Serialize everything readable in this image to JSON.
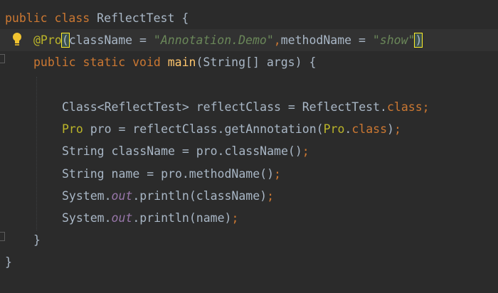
{
  "editor": {
    "lines": [
      {
        "tokens": [
          {
            "t": "public class ",
            "c": "kw"
          },
          {
            "t": "ReflectTest {",
            "c": "plain"
          }
        ]
      },
      {
        "current": true,
        "tokens": [
          {
            "t": "@Pro",
            "c": "ann"
          },
          {
            "t": "(",
            "c": "brace-hl"
          },
          {
            "t": "className = ",
            "c": "plain"
          },
          {
            "t": "\"Annotation.Demo\"",
            "c": "str"
          },
          {
            "t": ",",
            "c": "kw"
          },
          {
            "t": "methodName = ",
            "c": "plain"
          },
          {
            "t": "\"show\"",
            "c": "str"
          },
          {
            "t": ")",
            "c": "brace-hl"
          }
        ]
      },
      {
        "tokens": [
          {
            "t": "public static void ",
            "c": "kw"
          },
          {
            "t": "main",
            "c": "fn"
          },
          {
            "t": "(String[] args) {",
            "c": "plain"
          }
        ]
      },
      {
        "tokens": []
      },
      {
        "tokens": [
          {
            "t": "Class<ReflectTest> reflectClass = ReflectTest.",
            "c": "plain"
          },
          {
            "t": "class;",
            "c": "kw"
          }
        ]
      },
      {
        "tokens": [
          {
            "t": "Pro ",
            "c": "ann"
          },
          {
            "t": "pro = reflectClass.getAnnotation(",
            "c": "plain"
          },
          {
            "t": "Pro",
            "c": "ann"
          },
          {
            "t": ".",
            "c": "plain"
          },
          {
            "t": "class",
            "c": "kw"
          },
          {
            "t": ")",
            "c": "plain"
          },
          {
            "t": ";",
            "c": "kw"
          }
        ]
      },
      {
        "tokens": [
          {
            "t": "String className = pro.className()",
            "c": "plain"
          },
          {
            "t": ";",
            "c": "kw"
          }
        ]
      },
      {
        "tokens": [
          {
            "t": "String name = pro.methodName()",
            "c": "plain"
          },
          {
            "t": ";",
            "c": "kw"
          }
        ]
      },
      {
        "tokens": [
          {
            "t": "System.",
            "c": "plain"
          },
          {
            "t": "out",
            "c": "fld"
          },
          {
            "t": ".println(className)",
            "c": "plain"
          },
          {
            "t": ";",
            "c": "kw"
          }
        ]
      },
      {
        "tokens": [
          {
            "t": "System.",
            "c": "plain"
          },
          {
            "t": "out",
            "c": "fld"
          },
          {
            "t": ".println(name)",
            "c": "plain"
          },
          {
            "t": ";",
            "c": "kw"
          }
        ]
      },
      {
        "tokens": [
          {
            "t": "}",
            "c": "plain"
          }
        ]
      },
      {
        "tokens": [
          {
            "t": "}",
            "c": "plain"
          }
        ]
      }
    ]
  },
  "icons": {
    "intention": "lightbulb-icon",
    "fold": "fold-marker-icon"
  },
  "colors": {
    "background": "#2b2b2b",
    "current_line": "#323232",
    "keyword": "#cc7832",
    "annotation": "#bbb529",
    "string": "#6a8759",
    "field": "#9876aa",
    "method_decl": "#ffc66d",
    "text": "#a9b7c6"
  }
}
